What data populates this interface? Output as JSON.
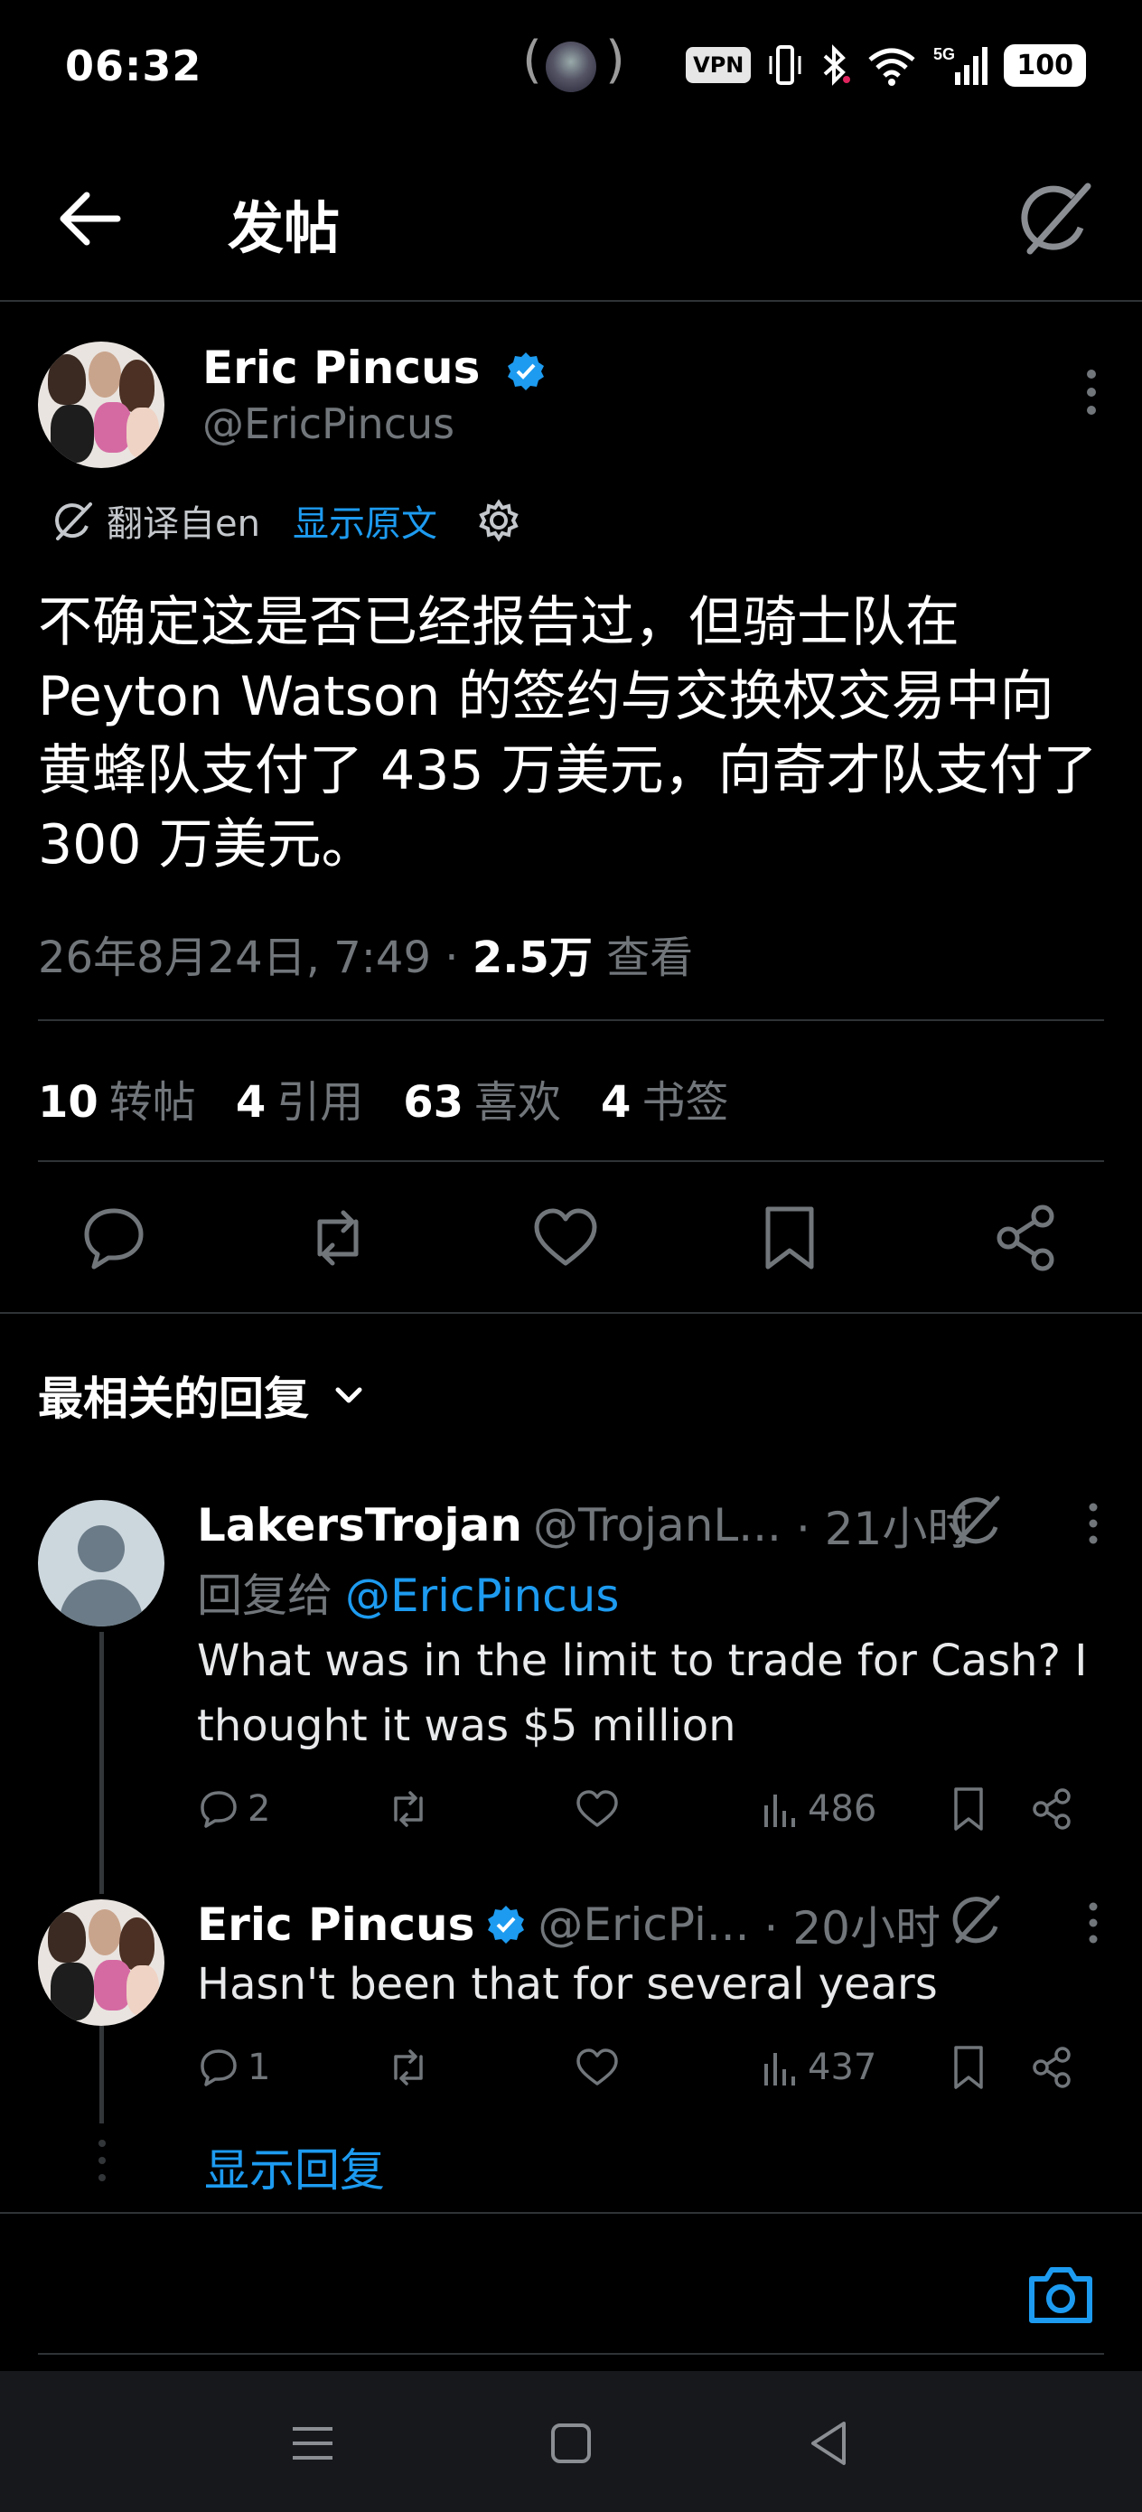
{
  "status_bar": {
    "time": "06:32",
    "vpn_label": "VPN",
    "network_label": "5G",
    "battery": "100"
  },
  "header": {
    "title": "发帖"
  },
  "tweet": {
    "author_name": "Eric Pincus",
    "author_handle": "@EricPincus",
    "translated_label": "翻译自en",
    "show_original_label": "显示原文",
    "text": "不确定这是否已经报告过，但骑士队在 Peyton Watson 的签约与交换权交易中向黄蜂队支付了 435 万美元，向奇才队支付了 300 万美元。",
    "date": "26年8月24日, 7:49",
    "meta_separator": "·",
    "views_count": "2.5万",
    "views_label": "查看",
    "stats": [
      {
        "count": "10",
        "label": "转帖"
      },
      {
        "count": "4",
        "label": "引用"
      },
      {
        "count": "63",
        "label": "喜欢"
      },
      {
        "count": "4",
        "label": "书签"
      }
    ]
  },
  "replies_section": {
    "sort_label": "最相关的回复"
  },
  "replies": [
    {
      "name": "LakersTrojan",
      "handle": "@TrojanL...",
      "time": "· 21小时",
      "reply_to_prefix": "回复给",
      "reply_to_mention": "@EricPincus",
      "text": "What was in the limit to trade for Cash? I thought it was $5 million",
      "reply_count": "2",
      "views": "486"
    },
    {
      "name": "Eric Pincus",
      "handle": "@EricPi...",
      "time": "· 20小时",
      "text": "Hasn't been that for several years",
      "reply_count": "1",
      "views": "437"
    }
  ],
  "show_replies_label": "显示回复",
  "colors": {
    "accent": "#1d9bf0",
    "background": "#000000",
    "muted_text": "#71767b",
    "divider": "#2f3336"
  }
}
